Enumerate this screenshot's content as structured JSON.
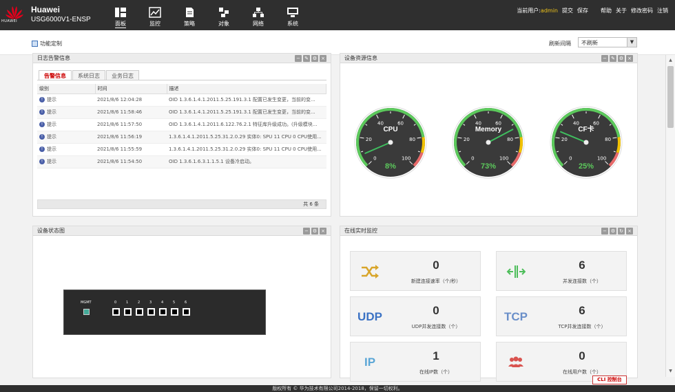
{
  "header": {
    "brand_name": "Huawei",
    "device_model": "USG6000V1-ENSP",
    "logo_text": "HUAWEI",
    "nav": [
      {
        "label": "面板",
        "icon": "dashboard-icon"
      },
      {
        "label": "监控",
        "icon": "monitor-icon"
      },
      {
        "label": "策略",
        "icon": "policy-icon"
      },
      {
        "label": "对象",
        "icon": "object-icon"
      },
      {
        "label": "网络",
        "icon": "network-icon"
      },
      {
        "label": "系统",
        "icon": "system-icon"
      }
    ],
    "current_user_label": "当前用户:",
    "current_user": "admin",
    "links": [
      "提交",
      "保存",
      "帮助",
      "关于",
      "修改密码",
      "注销"
    ]
  },
  "toolbar": {
    "customize_label": "功能定制",
    "refresh_label": "刷新间隔",
    "refresh_value": "不刷新"
  },
  "log_panel": {
    "title": "日志告警信息",
    "tabs": [
      "告警信息",
      "系统日志",
      "业务日志"
    ],
    "columns": [
      "级别",
      "时间",
      "描述"
    ],
    "rows": [
      {
        "level": "提示",
        "time": "2021/8/6 12:04:28",
        "desc": "OID 1.3.6.1.4.1.2011.5.25.191.3.1 配置已发生变更，当前的变..."
      },
      {
        "level": "提示",
        "time": "2021/8/6 11:58:46",
        "desc": "OID 1.3.6.1.4.1.2011.5.25.191.3.1 配置已发生变更，当前的变..."
      },
      {
        "level": "提示",
        "time": "2021/8/6 11:57:50",
        "desc": "OID 1.3.6.1.4.1.2011.6.122.76.2.1 特征库升级成功。(升级模块..."
      },
      {
        "level": "提示",
        "time": "2021/8/6 11:56:19",
        "desc": "1.3.6.1.4.1.2011.5.25.31.2.0.29 实体0: SPU 11 CPU 0 CPU使用..."
      },
      {
        "level": "提示",
        "time": "2021/8/6 11:55:59",
        "desc": "1.3.6.1.4.1.2011.5.25.31.2.0.29 实体0: SPU 11 CPU 0 CPU使用..."
      },
      {
        "level": "提示",
        "time": "2021/8/6 11:54:50",
        "desc": "OID 1.3.6.1.6.3.1.1.5.1 设备冷启动。"
      }
    ],
    "footer": "共 6 条"
  },
  "resource_panel": {
    "title": "设备资源信息",
    "gauges": [
      {
        "name": "CPU",
        "value": 8,
        "label": "8%"
      },
      {
        "name": "Memory",
        "value": 73,
        "label": "73%"
      },
      {
        "name": "CF卡",
        "value": 25,
        "label": "25%"
      }
    ],
    "tick_labels": [
      "0",
      "20",
      "40",
      "60",
      "80",
      "100"
    ]
  },
  "status_panel": {
    "title": "设备状态图",
    "mgmt_label": "MGMT",
    "ports": [
      "0",
      "1",
      "2",
      "3",
      "4",
      "5",
      "6"
    ]
  },
  "monitor_panel": {
    "title": "在线实时监控",
    "cards": [
      {
        "value": "0",
        "label": "新建连接速率（个/秒）",
        "icon": "shuffle-icon"
      },
      {
        "value": "6",
        "label": "并发连接数（个）",
        "icon": "split-arrows-icon"
      },
      {
        "value": "0",
        "label": "UDP并发连接数（个）",
        "icon": "udp-icon",
        "icon_text": "UDP"
      },
      {
        "value": "6",
        "label": "TCP并发连接数（个）",
        "icon": "tcp-icon",
        "icon_text": "TCP"
      },
      {
        "value": "1",
        "label": "在线IP数（个）",
        "icon": "ip-icon",
        "icon_text": "IP"
      },
      {
        "value": "0",
        "label": "在线用户数（个）",
        "icon": "users-icon"
      }
    ]
  },
  "cli_button": "CLI 控制台",
  "footer": "版权所有 © 华为技术有限公司2014-2018，保留一切权利。",
  "colors": {
    "topbar": "#2f2f2f",
    "gauge_green": "#5cc95c",
    "gauge_red": "#e86a6a",
    "gauge_yellow": "#f2c200",
    "needle": "#3fbf5f",
    "udp_blue": "#3b72c4",
    "tcp_blue": "#6a8fc9",
    "shuffle_gold": "#d8a52a",
    "split_green": "#4dbd5a",
    "users_red": "#d9534f"
  }
}
